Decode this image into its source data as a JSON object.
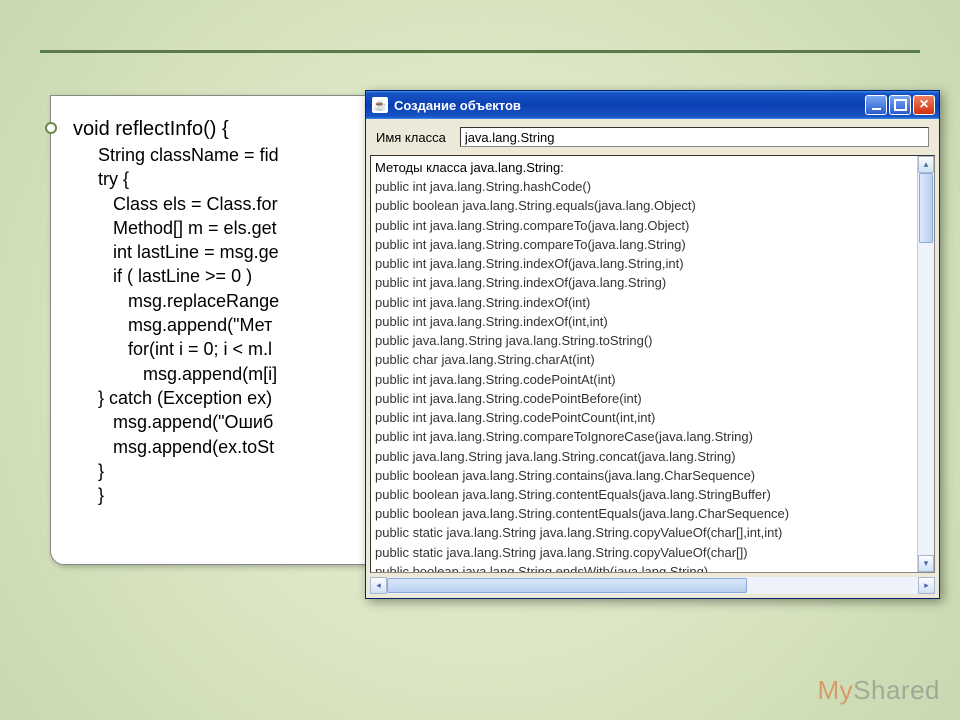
{
  "code": {
    "l1": "void reflectInfo() {",
    "l2": "     String className = fid",
    "l3": "     try {",
    "l4": "        Class els = Class.for",
    "l5": "        Method[] m = els.get",
    "l6": "        int lastLine = msg.ge",
    "l7": "        if ( lastLine >= 0 )",
    "l8": "           msg.replaceRange",
    "l9": "           msg.append(\"Мет",
    "l10": "           for(int i = 0; i < m.l",
    "l11": "              msg.append(m[i]",
    "l12": "     } catch (Exception ex)",
    "l13": "        msg.append(\"Ошиб",
    "l14": "        msg.append(ex.toSt",
    "l15": "     }",
    "l16": "     }"
  },
  "window": {
    "title": "Создание объектов",
    "label_classname": "Имя класса",
    "input_value": "java.lang.String",
    "output_header": "Методы класса java.lang.String:",
    "lines": [
      "public int java.lang.String.hashCode()",
      "public boolean java.lang.String.equals(java.lang.Object)",
      "public int java.lang.String.compareTo(java.lang.Object)",
      "public int java.lang.String.compareTo(java.lang.String)",
      "public int java.lang.String.indexOf(java.lang.String,int)",
      "public int java.lang.String.indexOf(java.lang.String)",
      "public int java.lang.String.indexOf(int)",
      "public int java.lang.String.indexOf(int,int)",
      "public java.lang.String java.lang.String.toString()",
      "public char java.lang.String.charAt(int)",
      "public int java.lang.String.codePointAt(int)",
      "public int java.lang.String.codePointBefore(int)",
      "public int java.lang.String.codePointCount(int,int)",
      "public int java.lang.String.compareToIgnoreCase(java.lang.String)",
      "public java.lang.String java.lang.String.concat(java.lang.String)",
      "public boolean java.lang.String.contains(java.lang.CharSequence)",
      "public boolean java.lang.String.contentEquals(java.lang.StringBuffer)",
      "public boolean java.lang.String.contentEquals(java.lang.CharSequence)",
      "public static java.lang.String java.lang.String.copyValueOf(char[],int,int)",
      "public static java.lang.String java.lang.String.copyValueOf(char[])",
      "public boolean java.lang.String.endsWith(java.lang.String)"
    ]
  },
  "watermark": {
    "left": "My",
    "right": "Shared"
  }
}
